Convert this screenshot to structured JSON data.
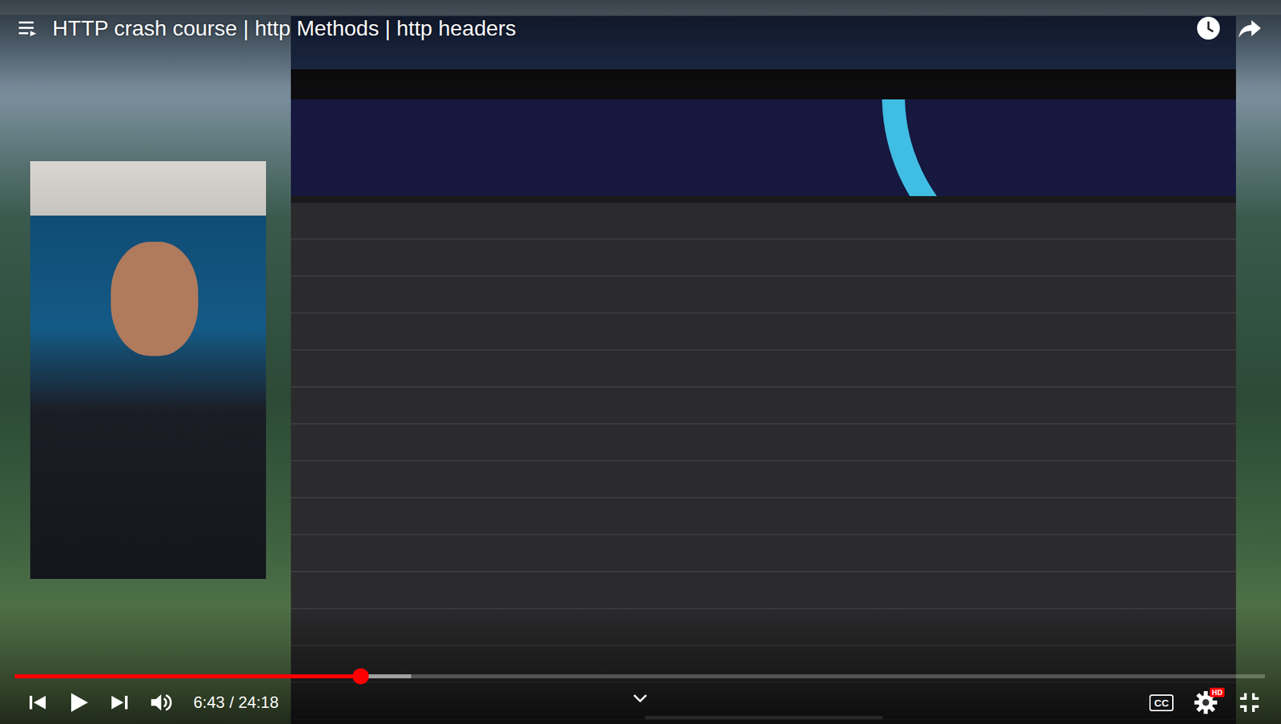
{
  "video": {
    "title": "HTTP crash course | http Methods | http headers"
  },
  "player": {
    "paused": true,
    "progress": {
      "level": 0.277,
      "buffered": 0.317
    },
    "time": "6:43 / 24:18",
    "captions": {
      "label": "CC",
      "on": false
    },
    "quality_badge": "HD"
  }
}
